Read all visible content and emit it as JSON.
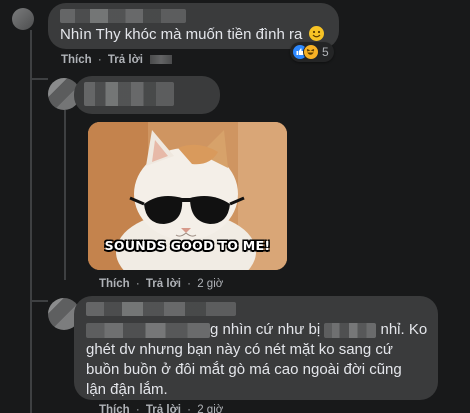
{
  "comments": [
    {
      "text": "Nhìn Thy khóc mà muốn tiền đình ra",
      "emoji_icon": "smile-emoji",
      "reactions": {
        "types": [
          "like",
          "haha"
        ],
        "count": "5"
      },
      "actions": {
        "like": "Thích",
        "reply": "Trả lời",
        "separator": "·"
      }
    },
    {
      "gif": {
        "caption": "SOUNDS GOOD TO ME!"
      },
      "actions": {
        "like": "Thích",
        "reply": "Trả lời",
        "time": "2 giờ",
        "separator": "·"
      }
    },
    {
      "lines": [
        {
          "before": "",
          "mid": "g nhìn cứ như bị",
          "after": "nhỉ. Ko"
        },
        "ghét dv nhưng bạn này có nét mặt ko sang cứ",
        "buồn buồn ở đôi mắt gò má cao ngoài đời cũng",
        "lận đận lắm."
      ],
      "actions": {
        "like": "Thích",
        "reply": "Trả lời",
        "time": "2 giờ",
        "separator": "·"
      }
    }
  ],
  "colors": {
    "background": "#18191a",
    "bubble": "#3a3b3c",
    "text": "#e4e6eb",
    "secondary_text": "#b0b3b8",
    "like_blue": "#2d88ff"
  }
}
